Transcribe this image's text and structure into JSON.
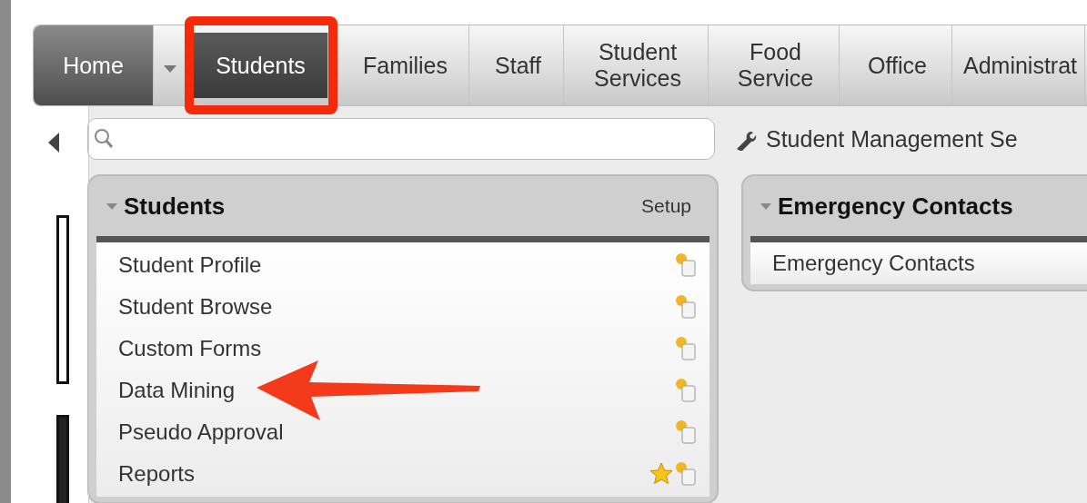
{
  "nav_tabs": [
    {
      "label": "Home",
      "kind": "home",
      "selected": false
    },
    {
      "label": "Students",
      "kind": "tab",
      "selected": true
    },
    {
      "label": "Families",
      "kind": "tab",
      "selected": false
    },
    {
      "label": "Staff",
      "kind": "tab",
      "selected": false
    },
    {
      "label": "Student\nServices",
      "kind": "tab",
      "selected": false
    },
    {
      "label": "Food\nService",
      "kind": "tab",
      "selected": false
    },
    {
      "label": "Office",
      "kind": "tab",
      "selected": false
    },
    {
      "label": "Administrat",
      "kind": "tab",
      "selected": false
    }
  ],
  "settings_link": "Student Management Se",
  "panels": [
    {
      "title": "Students",
      "expanded": true,
      "action": "Setup",
      "items": [
        {
          "label": "Student Profile",
          "favorite": false
        },
        {
          "label": "Student Browse",
          "favorite": false
        },
        {
          "label": "Custom Forms",
          "favorite": false
        },
        {
          "label": "Data Mining",
          "favorite": false
        },
        {
          "label": "Pseudo Approval",
          "favorite": false
        },
        {
          "label": "Reports",
          "favorite": true
        }
      ]
    },
    {
      "title": "Emergency Contacts",
      "expanded": true,
      "items": [
        {
          "label": "Emergency Contacts"
        }
      ]
    }
  ]
}
